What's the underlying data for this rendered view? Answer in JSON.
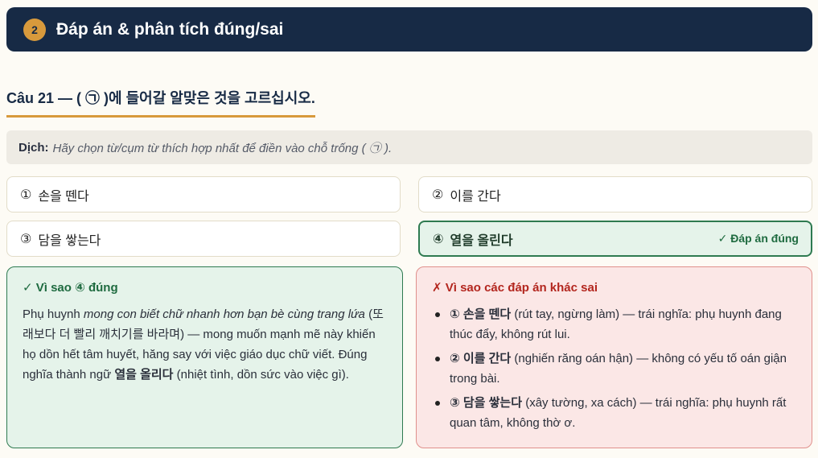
{
  "header": {
    "step": "2",
    "title": "Đáp án & phân tích đúng/sai"
  },
  "question": {
    "text": "Câu 21 — ( ㉠ )에 들어갈 알맞은 것을 고르십시오."
  },
  "translation": {
    "label": "Dịch:",
    "text": "Hãy chọn từ/cụm từ thích hợp nhất để điền vào chỗ trống ( ㉠ )."
  },
  "options": [
    {
      "num": "①",
      "text": "손을 뗀다"
    },
    {
      "num": "②",
      "text": "이를 간다"
    },
    {
      "num": "③",
      "text": "담을 쌓는다"
    },
    {
      "num": "④",
      "text": "열을 올린다",
      "badge": "✓ Đáp án đúng"
    }
  ],
  "correct_panel": {
    "title": "✓ Vì sao ④ đúng",
    "p1": "Phụ huynh ",
    "p1_italic": "mong con biết chữ nhanh hơn bạn bè cùng trang lứa",
    "p2": " (또래보다 더 빨리 깨치기를 바라며) — mong muốn mạnh mẽ này khiến họ dồn hết tâm huyết, hăng say với việc giáo dục chữ viết. Đúng nghĩa thành ngữ ",
    "p2_bold": "열을 올리다",
    "p3": " (nhiệt tình, dồn sức vào việc gì)."
  },
  "wrong_panel": {
    "title": "✗ Vì sao các đáp án khác sai",
    "items": [
      {
        "bold": "① 손을 뗀다",
        "text": " (rút tay, ngừng làm) — trái nghĩa: phụ huynh đang thúc đẩy, không rút lui."
      },
      {
        "bold": "② 이를 간다",
        "text": " (nghiến răng oán hận) — không có yếu tố oán giận trong bài."
      },
      {
        "bold": "③ 담을 쌓는다",
        "text": " (xây tường, xa cách) — trái nghĩa: phụ huynh rất quan tâm, không thờ ơ."
      }
    ]
  }
}
